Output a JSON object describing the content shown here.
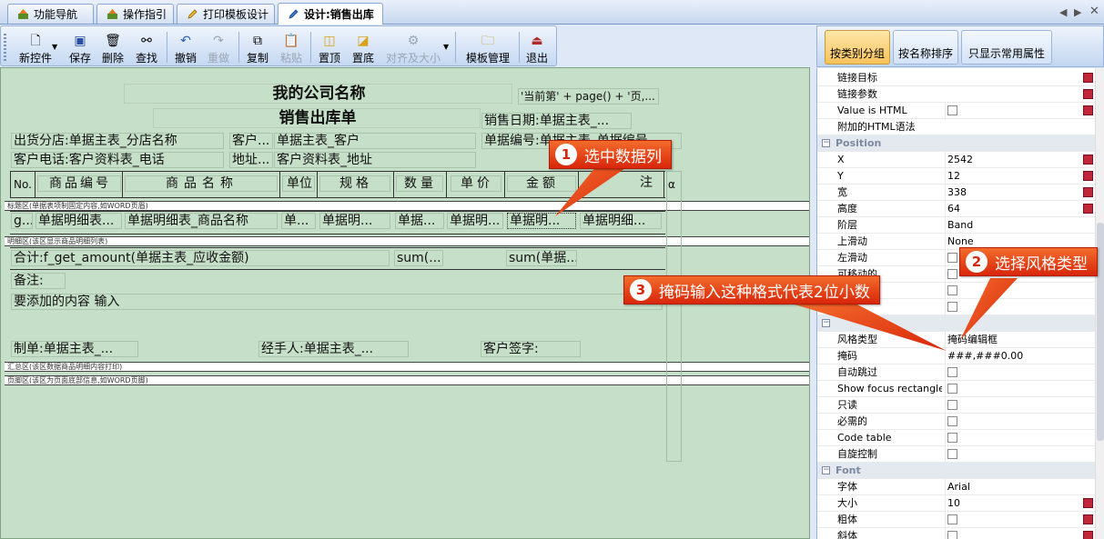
{
  "tabs": [
    {
      "label": "功能导航",
      "icon": "nav-icon"
    },
    {
      "label": "操作指引",
      "icon": "guide-icon"
    },
    {
      "label": "打印模板设计",
      "icon": "pencil-icon"
    },
    {
      "label": "设计:销售出库",
      "icon": "pencil-icon",
      "active": true
    }
  ],
  "toolbar": {
    "new": "新控件",
    "save": "保存",
    "delete": "删除",
    "find": "查找",
    "undo": "撤销",
    "redo": "重做",
    "copy": "复制",
    "paste": "粘贴",
    "top": "置顶",
    "bottom": "置底",
    "align": "对齐及大小",
    "template": "模板管理",
    "exit": "退出"
  },
  "panel_tabs": [
    "按类别分组",
    "按名称排序",
    "只显示常用属性"
  ],
  "report": {
    "company": "我的公司名称",
    "page_expr": "'当前第' + page() + '页,...",
    "title": "销售出库单",
    "sale_date": "销售日期:单据主表_...",
    "branch": "出货分店:单据主表_分店名称",
    "customer_label": "客户...",
    "customer": "单据主表_客户",
    "doc_no": "单据编号:单据主表_单据编号",
    "phone": "客户电话:客户资料表_电话",
    "addr_label": "地址...",
    "addr": "客户资料表_地址",
    "col_no": "No.",
    "col_code": "商品编号",
    "col_name": "商品名称",
    "col_unit": "单位",
    "col_spec": "规格",
    "col_qty": "数量",
    "col_price": "单价",
    "col_amount": "金额",
    "col_note": "注",
    "col_extra": "α",
    "band_title": "标题区(单据表项制固定内容,如WORD页眉)",
    "row_g": "g...",
    "row_code": "单据明细表...",
    "row_name": "单据明细表_商品名称",
    "row_unit": "单...",
    "row_spec": "单据明...",
    "row_qty": "单据...",
    "row_price": "单据明...",
    "row_amount": "单据明...",
    "row_note": "单据明细...",
    "band_detail": "明细区(该区显示商品明细列表)",
    "total": "合计:f_get_amount(单据主表_应收金额)",
    "sum_qty": "sum(...",
    "sum_amount": "sum(单据...",
    "remark_label": "备注:",
    "remark_text": "要添加的内容 输入",
    "maker": "制单:单据主表_...",
    "handler": "经手人:单据主表_...",
    "sign": "客户签字:",
    "band_summary": "汇总区(该区数据商品明细内容打印)",
    "band_footer": "页脚区(该区为页面底部信息,如WORD页脚)"
  },
  "properties": [
    {
      "name": "链接目标",
      "value": "",
      "flag": true
    },
    {
      "name": "链接参数",
      "value": "",
      "flag": true
    },
    {
      "name": "Value is HTML",
      "check": true,
      "flag": true
    },
    {
      "name": "附加的HTML语法",
      "value": ""
    },
    {
      "category": "Position"
    },
    {
      "name": "X",
      "value": "2542",
      "flag": true
    },
    {
      "name": "Y",
      "value": "12",
      "flag": true
    },
    {
      "name": "宽",
      "value": "338",
      "flag": true
    },
    {
      "name": "高度",
      "value": "64",
      "flag": true
    },
    {
      "name": "阶层",
      "value": "Band"
    },
    {
      "name": "上滑动",
      "value": "None"
    },
    {
      "name": "左滑动",
      "check": true
    },
    {
      "name": "可移动的",
      "check": true
    },
    {
      "name": "",
      "check": true
    },
    {
      "name": "",
      "check": true
    },
    {
      "category": ""
    },
    {
      "name": "风格类型",
      "value": "掩码编辑框"
    },
    {
      "name": "掩码",
      "value": "###,###0.00"
    },
    {
      "name": "自动跳过",
      "check": true
    },
    {
      "name": "Show focus rectangle",
      "check": true
    },
    {
      "name": "只读",
      "check": true
    },
    {
      "name": "必需的",
      "check": true
    },
    {
      "name": "Code table",
      "check": true
    },
    {
      "name": "自旋控制",
      "check": true
    },
    {
      "category": "Font"
    },
    {
      "name": "字体",
      "value": "Arial"
    },
    {
      "name": "大小",
      "value": "10",
      "flag": true
    },
    {
      "name": "粗体",
      "check": true,
      "flag": true
    },
    {
      "name": "斜体",
      "check": true,
      "flag": true
    }
  ],
  "callouts": [
    {
      "num": "1",
      "text": "选中数据列"
    },
    {
      "num": "2",
      "text": "选择风格类型"
    },
    {
      "num": "3",
      "text": "掩码输入这种格式代表2位小数"
    }
  ],
  "colors": {
    "canvas": "#c6dfc8",
    "callout": "#e0380f",
    "active_tab": "#f7c25c"
  }
}
